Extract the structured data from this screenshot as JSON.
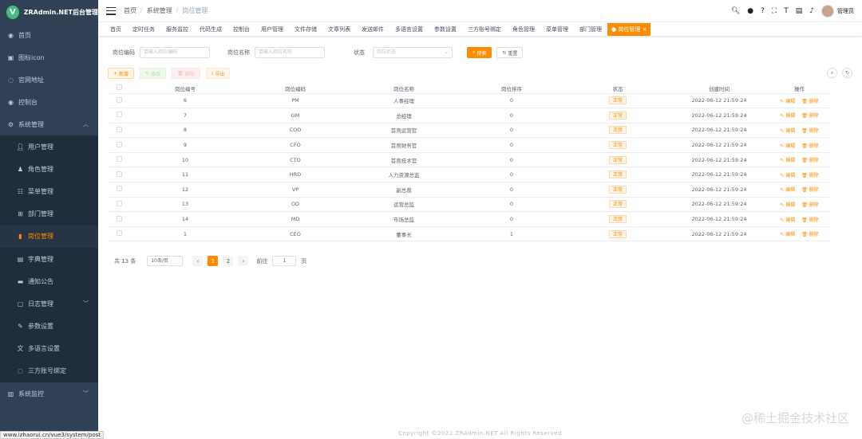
{
  "sidebar": {
    "logo_letter": "V",
    "app_name": "ZRAdmin.NET后台管理",
    "items": [
      {
        "label": "首页",
        "icon": "dashboard-icon"
      },
      {
        "label": "图标icon",
        "icon": "icon-icon"
      },
      {
        "label": "官网地址",
        "icon": "link-icon"
      },
      {
        "label": "控制台",
        "icon": "dashboard-icon"
      },
      {
        "label": "系统管理",
        "icon": "gear-icon"
      },
      {
        "label": "用户管理",
        "icon": "user-icon"
      },
      {
        "label": "角色管理",
        "icon": "role-icon"
      },
      {
        "label": "菜单管理",
        "icon": "tree-icon"
      },
      {
        "label": "部门管理",
        "icon": "dept-icon"
      },
      {
        "label": "岗位管理",
        "icon": "post-icon"
      },
      {
        "label": "字典管理",
        "icon": "dict-icon"
      },
      {
        "label": "通知公告",
        "icon": "message-icon"
      },
      {
        "label": "日志管理",
        "icon": "log-icon"
      },
      {
        "label": "参数设置",
        "icon": "edit-icon"
      },
      {
        "label": "多语言设置",
        "icon": "language-icon"
      },
      {
        "label": "三方账号绑定",
        "icon": "link-icon"
      },
      {
        "label": "系统监控",
        "icon": "monitor-icon"
      }
    ]
  },
  "status_url": "www.izhaorui.cn/vue3/system/post",
  "breadcrumb": [
    "首页",
    "系统管理",
    "岗位管理"
  ],
  "header": {
    "user_name": "管理员"
  },
  "tags": [
    "首页",
    "定时任务",
    "服务监控",
    "代码生成",
    "控制台",
    "用户管理",
    "文件存储",
    "文章列表",
    "发送邮件",
    "多语言设置",
    "参数设置",
    "三方账号绑定",
    "角色管理",
    "菜单管理",
    "部门管理"
  ],
  "active_tag": "岗位管理",
  "filters": {
    "post_code_label": "岗位编码",
    "post_code_placeholder": "请输入岗位编码",
    "post_name_label": "岗位名称",
    "post_name_placeholder": "请输入岗位名称",
    "status_label": "状态",
    "status_placeholder": "岗位状态",
    "search_label": "搜索",
    "reset_label": "重置"
  },
  "actions": {
    "add": "新增",
    "edit": "修改",
    "delete": "删除",
    "export": "导出"
  },
  "table": {
    "columns": [
      "岗位编号",
      "岗位编码",
      "岗位名称",
      "岗位排序",
      "状态",
      "创建时间",
      "操作"
    ],
    "edit_label": "编辑",
    "delete_label": "删除",
    "rows": [
      {
        "id": "6",
        "code": "PM",
        "name": "人事经理",
        "sort": "0",
        "status": "正常",
        "time": "2022-06-12 21:59:24"
      },
      {
        "id": "7",
        "code": "GM",
        "name": "总经理",
        "sort": "0",
        "status": "正常",
        "time": "2022-06-12 21:59:24"
      },
      {
        "id": "8",
        "code": "COO",
        "name": "首席运营官",
        "sort": "0",
        "status": "正常",
        "time": "2022-06-12 21:59:24"
      },
      {
        "id": "9",
        "code": "CFO",
        "name": "首席财务官",
        "sort": "0",
        "status": "正常",
        "time": "2022-06-12 21:59:24"
      },
      {
        "id": "10",
        "code": "CTO",
        "name": "首席技术官",
        "sort": "0",
        "status": "正常",
        "time": "2022-06-12 21:59:24"
      },
      {
        "id": "11",
        "code": "HRD",
        "name": "人力资源总监",
        "sort": "0",
        "status": "正常",
        "time": "2022-06-12 21:59:24"
      },
      {
        "id": "12",
        "code": "VP",
        "name": "副总裁",
        "sort": "0",
        "status": "正常",
        "time": "2022-06-12 21:59:24"
      },
      {
        "id": "13",
        "code": "OD",
        "name": "运营总监",
        "sort": "0",
        "status": "正常",
        "time": "2022-06-12 21:59:24"
      },
      {
        "id": "14",
        "code": "MD",
        "name": "市场总监",
        "sort": "0",
        "status": "正常",
        "time": "2022-06-12 21:59:24"
      },
      {
        "id": "1",
        "code": "CEO",
        "name": "董事长",
        "sort": "1",
        "status": "正常",
        "time": "2022-06-12 21:59:24"
      }
    ]
  },
  "pager": {
    "total": "共 13 条",
    "page_size": "10条/页",
    "pages": [
      "1",
      "2"
    ],
    "goto_label": "前往",
    "goto_value": "1",
    "page_unit": "页"
  },
  "footer": "Copyright ©2022 ZRAdmin.NET All Rights Reserved",
  "watermark": "@稀土掘金技术社区",
  "colors": {
    "accent": "#ff8c00",
    "sidebar": "#304156"
  }
}
